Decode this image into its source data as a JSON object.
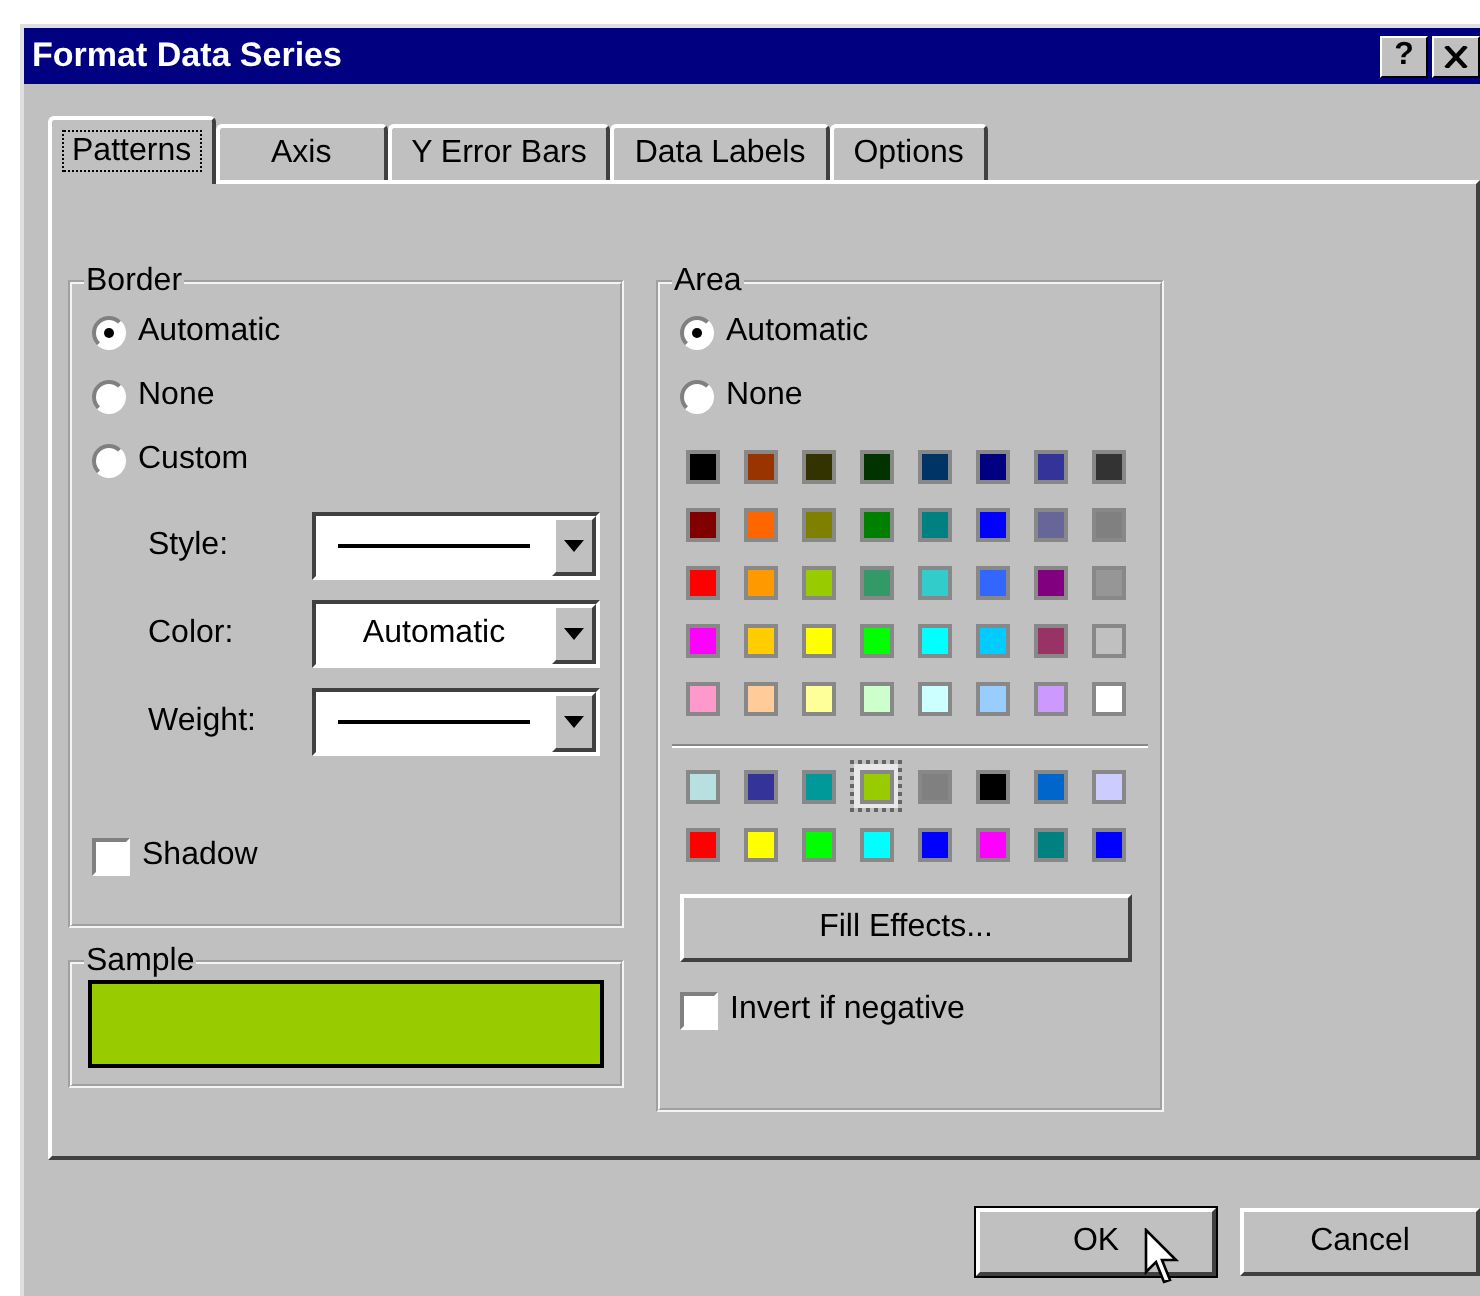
{
  "window": {
    "title": "Format Data Series",
    "help_button": "?"
  },
  "tabs": [
    {
      "label": "Patterns",
      "selected": true
    },
    {
      "label": "Axis",
      "selected": false
    },
    {
      "label": "Y Error Bars",
      "selected": false
    },
    {
      "label": "Data Labels",
      "selected": false
    },
    {
      "label": "Options",
      "selected": false
    }
  ],
  "border": {
    "title": "Border",
    "options": [
      {
        "label": "Automatic",
        "selected": true
      },
      {
        "label": "None",
        "selected": false
      },
      {
        "label": "Custom",
        "selected": false
      }
    ],
    "fields": [
      {
        "label": "Style:",
        "kind": "line"
      },
      {
        "label": "Color:",
        "kind": "text",
        "value": "Automatic"
      },
      {
        "label": "Weight:",
        "kind": "line"
      }
    ],
    "shadow": {
      "label": "Shadow",
      "checked": false
    }
  },
  "sample": {
    "title": "Sample"
  },
  "area": {
    "title": "Area",
    "options": [
      {
        "label": "Automatic",
        "selected": true
      },
      {
        "label": "None",
        "selected": false
      }
    ],
    "standard_colors": [
      {
        "color": "#000000",
        "selected": false
      },
      {
        "color": "#993300",
        "selected": false
      },
      {
        "color": "#333300",
        "selected": false
      },
      {
        "color": "#003300",
        "selected": false
      },
      {
        "color": "#003366",
        "selected": false
      },
      {
        "color": "#000080",
        "selected": false
      },
      {
        "color": "#333399",
        "selected": false
      },
      {
        "color": "#333333",
        "selected": false
      },
      {
        "color": "#800000",
        "selected": false
      },
      {
        "color": "#ff6600",
        "selected": false
      },
      {
        "color": "#808000",
        "selected": false
      },
      {
        "color": "#008000",
        "selected": false
      },
      {
        "color": "#008080",
        "selected": false
      },
      {
        "color": "#0000ff",
        "selected": false
      },
      {
        "color": "#666699",
        "selected": false
      },
      {
        "color": "#808080",
        "selected": false
      },
      {
        "color": "#ff0000",
        "selected": false
      },
      {
        "color": "#ff9900",
        "selected": false
      },
      {
        "color": "#99cc00",
        "selected": false
      },
      {
        "color": "#339966",
        "selected": false
      },
      {
        "color": "#33cccc",
        "selected": false
      },
      {
        "color": "#3366ff",
        "selected": false
      },
      {
        "color": "#800080",
        "selected": false
      },
      {
        "color": "#969696",
        "selected": false
      },
      {
        "color": "#ff00ff",
        "selected": false
      },
      {
        "color": "#ffcc00",
        "selected": false
      },
      {
        "color": "#ffff00",
        "selected": false
      },
      {
        "color": "#00ff00",
        "selected": false
      },
      {
        "color": "#00ffff",
        "selected": false
      },
      {
        "color": "#00ccff",
        "selected": false
      },
      {
        "color": "#993366",
        "selected": false
      },
      {
        "color": "#c0c0c0",
        "selected": false
      },
      {
        "color": "#ff99cc",
        "selected": false
      },
      {
        "color": "#ffcc99",
        "selected": false
      },
      {
        "color": "#ffff99",
        "selected": false
      },
      {
        "color": "#ccffcc",
        "selected": false
      },
      {
        "color": "#ccffff",
        "selected": false
      },
      {
        "color": "#99ccff",
        "selected": false
      },
      {
        "color": "#cc99ff",
        "selected": false
      },
      {
        "color": "#ffffff",
        "selected": false
      }
    ],
    "chart_colors": [
      {
        "color": "#b8e0e0",
        "selected": false
      },
      {
        "color": "#333399",
        "selected": false
      },
      {
        "color": "#009999",
        "selected": false
      },
      {
        "color": "#99cc00",
        "selected": true
      },
      {
        "color": "#808080",
        "selected": false
      },
      {
        "color": "#000000",
        "selected": false
      },
      {
        "color": "#0066cc",
        "selected": false
      },
      {
        "color": "#ccccff",
        "selected": false
      },
      {
        "color": "#ff0000",
        "selected": false
      },
      {
        "color": "#ffff00",
        "selected": false
      },
      {
        "color": "#00ff00",
        "selected": false
      },
      {
        "color": "#00ffff",
        "selected": false
      },
      {
        "color": "#0000ff",
        "selected": false
      },
      {
        "color": "#ff00ff",
        "selected": false
      },
      {
        "color": "#008080",
        "selected": false
      },
      {
        "color": "#0000ff",
        "selected": false
      }
    ],
    "fill_effects_button": "Fill Effects...",
    "invert": {
      "label": "Invert if negative",
      "checked": false
    }
  },
  "buttons": [
    {
      "label": "OK",
      "default": true
    },
    {
      "label": "Cancel",
      "default": false
    }
  ]
}
